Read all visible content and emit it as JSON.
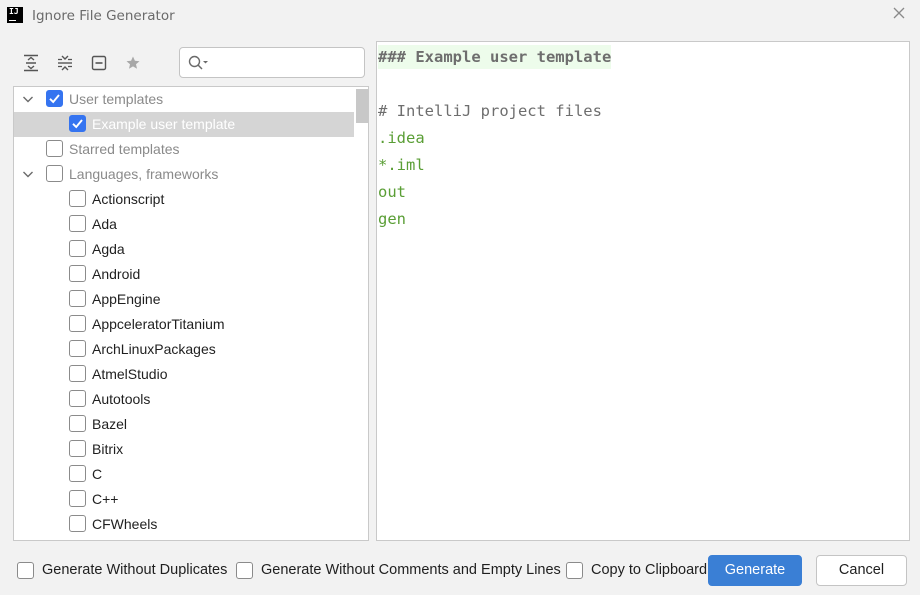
{
  "window": {
    "title": "Ignore File Generator",
    "logo_text": "IJ"
  },
  "toolbar": {
    "buttons": [
      {
        "name": "expand-all-icon"
      },
      {
        "name": "collapse-all-icon"
      },
      {
        "name": "remove-icon"
      },
      {
        "name": "star-icon"
      }
    ]
  },
  "search": {
    "placeholder": "",
    "value": ""
  },
  "tree": {
    "rows": [
      {
        "label": "User templates",
        "level": 0,
        "expandable": true,
        "checked": true,
        "muted": true,
        "selected": false
      },
      {
        "label": "Example user template",
        "level": 1,
        "expandable": false,
        "checked": true,
        "muted": false,
        "selected": true
      },
      {
        "label": "Starred templates",
        "level": 0,
        "expandable": false,
        "checked": false,
        "muted": true,
        "selected": false
      },
      {
        "label": "Languages, frameworks",
        "level": 0,
        "expandable": true,
        "checked": false,
        "muted": true,
        "selected": false
      },
      {
        "label": "Actionscript",
        "level": 1,
        "expandable": false,
        "checked": false,
        "muted": false,
        "selected": false
      },
      {
        "label": "Ada",
        "level": 1,
        "expandable": false,
        "checked": false,
        "muted": false,
        "selected": false
      },
      {
        "label": "Agda",
        "level": 1,
        "expandable": false,
        "checked": false,
        "muted": false,
        "selected": false
      },
      {
        "label": "Android",
        "level": 1,
        "expandable": false,
        "checked": false,
        "muted": false,
        "selected": false
      },
      {
        "label": "AppEngine",
        "level": 1,
        "expandable": false,
        "checked": false,
        "muted": false,
        "selected": false
      },
      {
        "label": "AppceleratorTitanium",
        "level": 1,
        "expandable": false,
        "checked": false,
        "muted": false,
        "selected": false
      },
      {
        "label": "ArchLinuxPackages",
        "level": 1,
        "expandable": false,
        "checked": false,
        "muted": false,
        "selected": false
      },
      {
        "label": "AtmelStudio",
        "level": 1,
        "expandable": false,
        "checked": false,
        "muted": false,
        "selected": false
      },
      {
        "label": "Autotools",
        "level": 1,
        "expandable": false,
        "checked": false,
        "muted": false,
        "selected": false
      },
      {
        "label": "Bazel",
        "level": 1,
        "expandable": false,
        "checked": false,
        "muted": false,
        "selected": false
      },
      {
        "label": "Bitrix",
        "level": 1,
        "expandable": false,
        "checked": false,
        "muted": false,
        "selected": false
      },
      {
        "label": "C",
        "level": 1,
        "expandable": false,
        "checked": false,
        "muted": false,
        "selected": false
      },
      {
        "label": "C++",
        "level": 1,
        "expandable": false,
        "checked": false,
        "muted": false,
        "selected": false
      },
      {
        "label": "CFWheels",
        "level": 1,
        "expandable": false,
        "checked": false,
        "muted": false,
        "selected": false
      }
    ]
  },
  "editor": {
    "lines": [
      {
        "text": "### Example user template",
        "style": "comment-bold",
        "highlight": true
      },
      {
        "text": "",
        "style": "plain",
        "highlight": false
      },
      {
        "text": "# IntelliJ project files",
        "style": "comment",
        "highlight": false
      },
      {
        "text": ".idea",
        "style": "green",
        "highlight": false
      },
      {
        "text": "*.iml",
        "style": "green",
        "highlight": false
      },
      {
        "text": "out",
        "style": "green",
        "highlight": false
      },
      {
        "text": "gen",
        "style": "green",
        "highlight": false
      }
    ]
  },
  "footer": {
    "checkboxes": [
      {
        "label": "Generate Without Duplicates",
        "checked": false
      },
      {
        "label": "Generate Without Comments and Empty Lines",
        "checked": false
      },
      {
        "label": "Copy to Clipboard",
        "checked": false
      }
    ],
    "generate_label": "Generate",
    "cancel_label": "Cancel"
  },
  "colors": {
    "accent": "#3574f0",
    "primary_button": "#3a7fd5",
    "selection": "#d5d5d5",
    "code_green": "#5a9e35",
    "code_comment": "#6e6e6e",
    "line_highlight": "#edfceb"
  }
}
